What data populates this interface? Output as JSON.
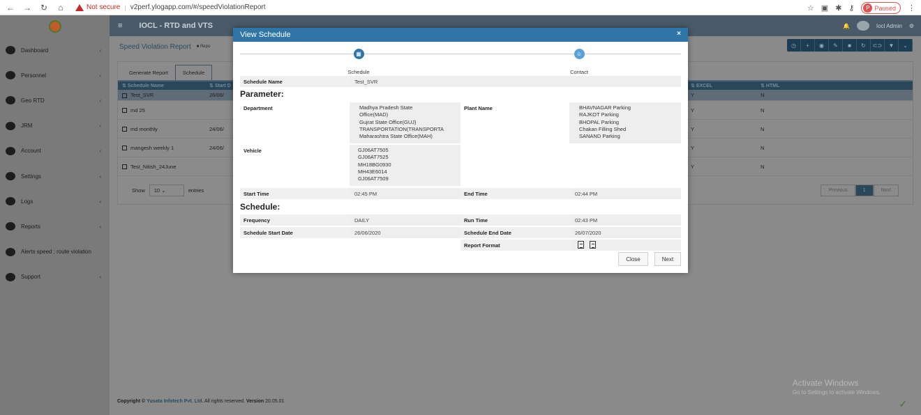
{
  "browser": {
    "not_secure": "Not secure",
    "url": "v2perf.ylogapp.com/#/speedViolationReport",
    "paused": "Paused"
  },
  "sidebar": {
    "items": [
      {
        "label": "Dashboard",
        "icon": "dashboard-icon"
      },
      {
        "label": "Personnel",
        "icon": "personnel-icon"
      },
      {
        "label": "Geo RTD",
        "icon": "location-icon"
      },
      {
        "label": "JRM",
        "icon": "jrm-icon"
      },
      {
        "label": "Account",
        "icon": "account-icon"
      },
      {
        "label": "Settings",
        "icon": "gear-icon"
      },
      {
        "label": "Logs",
        "icon": "logs-icon"
      },
      {
        "label": "Reports",
        "icon": "reports-icon"
      },
      {
        "label": "Alerts speed ; route violation",
        "icon": "bell-icon"
      },
      {
        "label": "Support",
        "icon": "support-icon"
      }
    ]
  },
  "topbar": {
    "title": "IOCL - RTD and VTS",
    "user": "Iocl Admin"
  },
  "page": {
    "title": "Speed Violation Report",
    "crumb": "Repo",
    "tabs": [
      "Generate Report",
      "Schedule"
    ]
  },
  "grid": {
    "headers": [
      "Schedule Name",
      "Start D",
      "EXCEL",
      "HTML"
    ],
    "rows": [
      {
        "name": "Test_SVR",
        "start": "26/06/",
        "excel": "Y",
        "html": "N"
      },
      {
        "name": "md 25",
        "start": "",
        "excel": "Y",
        "html": "N"
      },
      {
        "name": "md monthly",
        "start": "24/06/",
        "excel": "Y",
        "html": "N"
      },
      {
        "name": "mangesh weekly 1",
        "start": "24/06/",
        "excel": "Y",
        "html": "N"
      },
      {
        "name": "Test_Nitish_24June",
        "start": "",
        "excel": "Y",
        "html": "N"
      }
    ],
    "show": "Show",
    "page_size": "10",
    "entries": "entries",
    "previous": "Previous",
    "page": "1",
    "next": "Next"
  },
  "footer": {
    "copyright": "Copyright ©",
    "company": "Yusata Infotech Pvt. Ltd.",
    "rights": "All rights reserved.",
    "version_label": "Version",
    "version": "20.05.01"
  },
  "watermark": {
    "title": "Activate Windows",
    "sub": "Go to Settings to activate Windows."
  },
  "modal": {
    "title": "View Schedule",
    "close_x": "×",
    "steps": [
      "Schedule",
      "Contact"
    ],
    "schedule_name_label": "Schedule Name",
    "schedule_name": "Test_SVR",
    "parameter_title": "Parameter:",
    "department_label": "Department",
    "departments": [
      "Madhya Pradesh State",
      "Office(MAD)",
      "Gujrat State Office(GUJ)",
      "TRANSPORTATION(TRANSPORTA",
      "Maharashtra State Office(MAH)"
    ],
    "plant_label": "Plant Name",
    "plants": [
      "BHAVNAGAR Parking",
      "RAJKOT Parking",
      "BHOPAL Parking",
      "Chakan Filling Shed",
      "SANAND Parking"
    ],
    "vehicle_label": "Vehicle",
    "vehicles": [
      "GJ06AT7505",
      "GJ06AT7525",
      "MH18BG0930",
      "MH43E6014",
      "GJ06AT7509"
    ],
    "start_time_label": "Start Time",
    "start_time": "02:45 PM",
    "end_time_label": "End Time",
    "end_time": "02:44 PM",
    "schedule_title": "Schedule:",
    "frequency_label": "Frequency",
    "frequency": "DAILY",
    "run_time_label": "Run Time",
    "run_time": "02:43 PM",
    "start_date_label": "Schedule Start Date",
    "start_date": "26/06/2020",
    "end_date_label": "Schedule End Date",
    "end_date": "26/07/2020",
    "report_format_label": "Report Format",
    "close_btn": "Close",
    "next_btn": "Next"
  }
}
